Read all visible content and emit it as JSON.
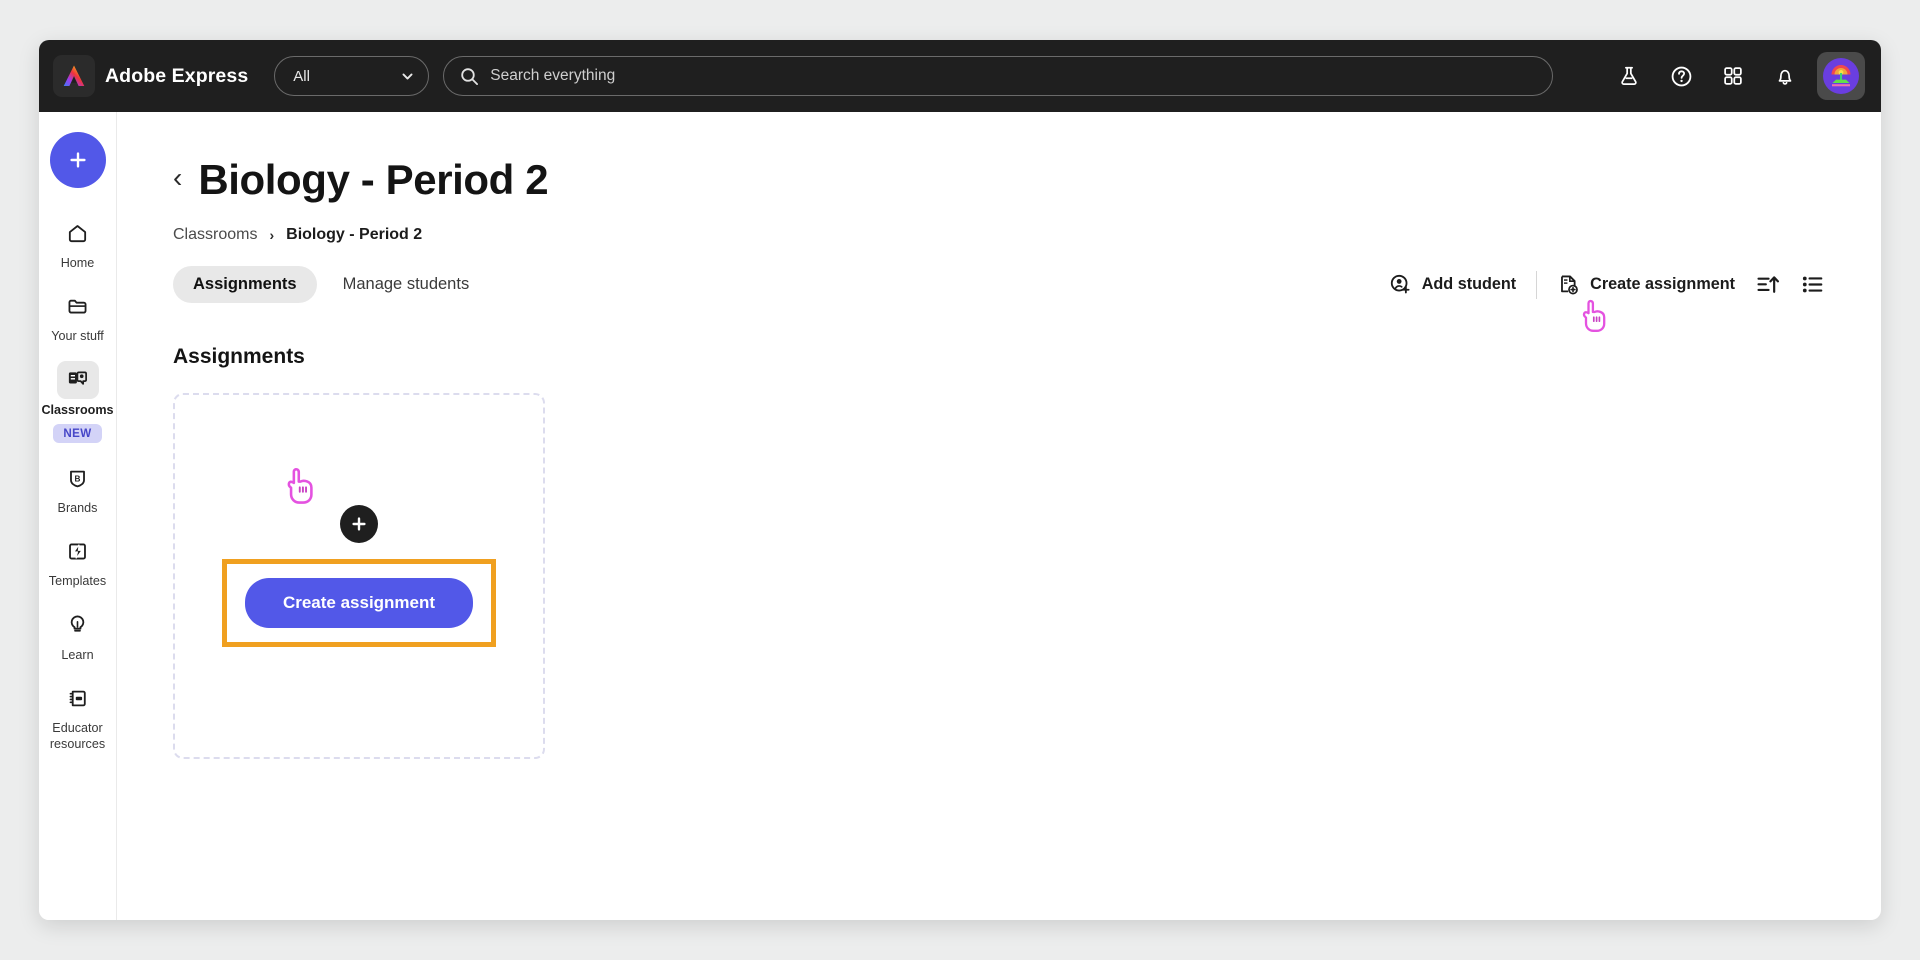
{
  "topbar": {
    "logo_icon": "adobe-express-logo",
    "brand": "Adobe Express",
    "filter": {
      "value": "All",
      "icon": "chevron-down-icon"
    },
    "search": {
      "placeholder": "Search everything",
      "icon": "search-icon"
    },
    "icons": [
      {
        "name": "flask-icon",
        "label": "Experiments"
      },
      {
        "name": "help-icon",
        "label": "Help"
      },
      {
        "name": "apps-grid-icon",
        "label": "Apps"
      },
      {
        "name": "bell-icon",
        "label": "Notifications"
      }
    ],
    "avatar": {
      "name": "avatar",
      "label": "Account"
    }
  },
  "rail": {
    "create_button": {
      "label": "Create new",
      "icon": "plus-icon"
    },
    "items": [
      {
        "label": "Home",
        "icon": "home-icon",
        "active": false,
        "badge": ""
      },
      {
        "label": "Your stuff",
        "icon": "folder-icon",
        "active": false,
        "badge": ""
      },
      {
        "label": "Classrooms",
        "icon": "classrooms-icon",
        "active": true,
        "badge": "NEW"
      },
      {
        "label": "Brands",
        "icon": "brand-shield-icon",
        "active": false,
        "badge": ""
      },
      {
        "label": "Templates",
        "icon": "templates-icon",
        "active": false,
        "badge": ""
      },
      {
        "label": "Learn",
        "icon": "lightbulb-icon",
        "active": false,
        "badge": ""
      },
      {
        "label": "Educator resources",
        "icon": "notebook-icon",
        "active": false,
        "badge": ""
      }
    ]
  },
  "page": {
    "back_icon": "chevron-left-icon",
    "title": "Biology - Period 2",
    "breadcrumb": {
      "root": "Classrooms",
      "separator": "›",
      "current": "Biology - Period 2"
    },
    "tabs": [
      {
        "label": "Assignments",
        "active": true
      },
      {
        "label": "Manage students",
        "active": false
      }
    ],
    "actions": {
      "add_student": {
        "label": "Add student",
        "icon": "add-student-icon"
      },
      "create_assignment": {
        "label": "Create assignment",
        "icon": "create-assignment-icon"
      },
      "sort": {
        "label": "Sort",
        "icon": "sort-ascending-icon"
      },
      "view": {
        "label": "View",
        "icon": "list-view-icon"
      }
    },
    "section_title": "Assignments",
    "empty_card": {
      "plus_icon": "plus-icon",
      "cta_label": "Create assignment"
    }
  },
  "colors": {
    "accent_blue": "#5258e8",
    "highlight_orange": "#f0a020",
    "cursor_pink": "#e452e0",
    "topbar_dark": "#1f1f1f",
    "badge_bg": "#d3d3f7",
    "badge_text": "#4646c8",
    "page_bg": "#eceded"
  }
}
